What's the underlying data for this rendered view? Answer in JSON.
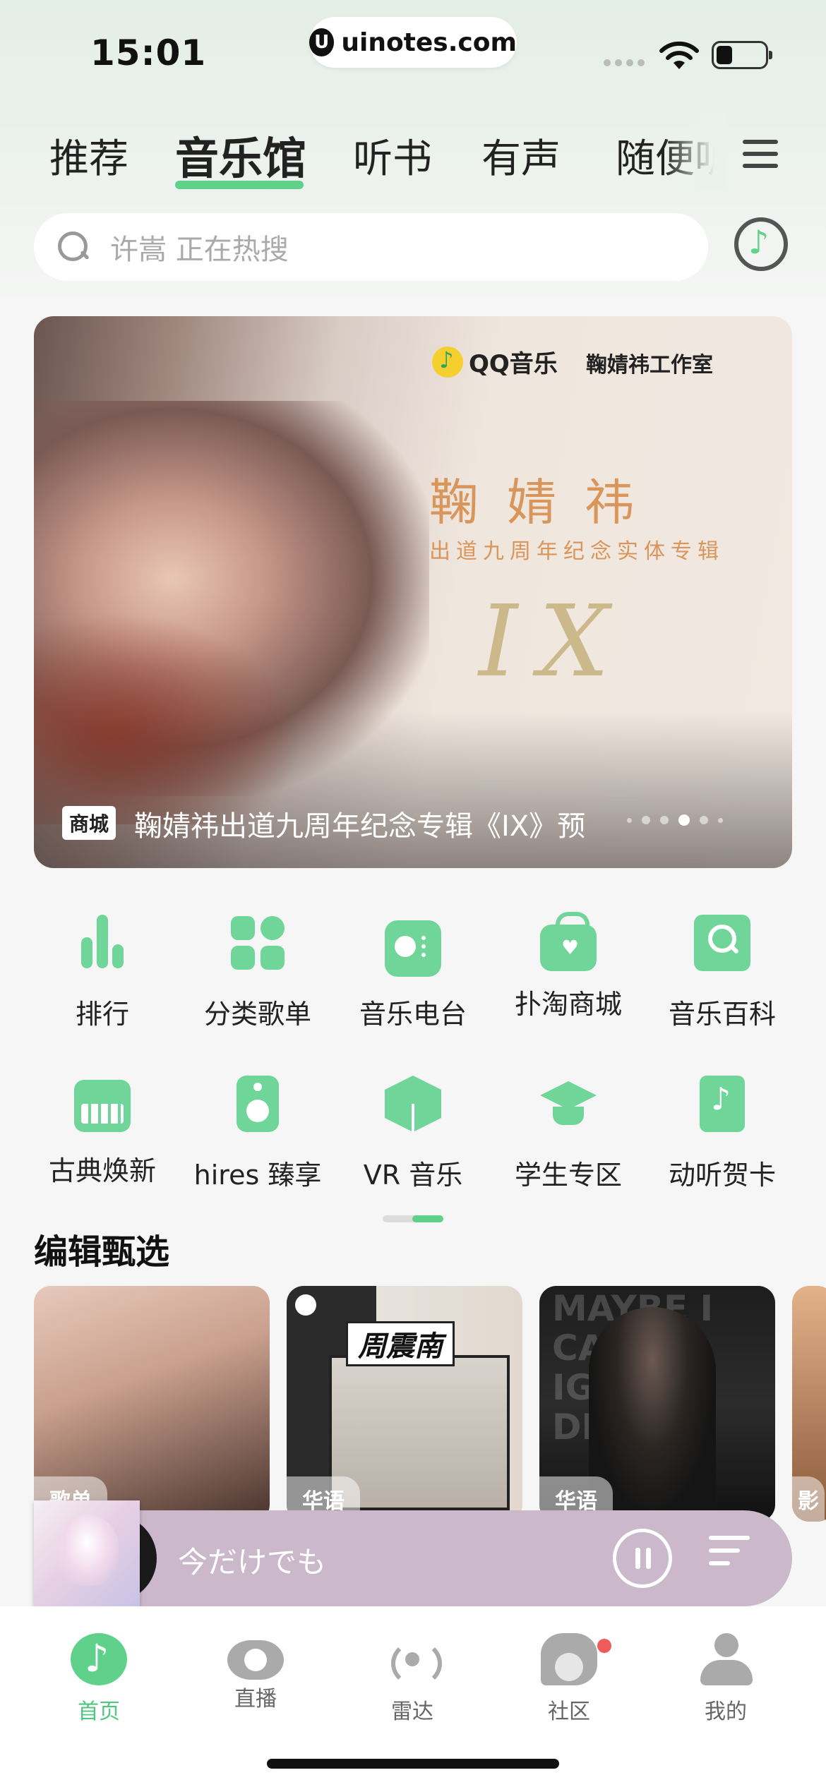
{
  "status_bar": {
    "time": "15:01",
    "url": "uinotes.com"
  },
  "top_tabs": [
    {
      "label": "推荐",
      "active": false
    },
    {
      "label": "音乐馆",
      "active": true
    },
    {
      "label": "听书",
      "active": false
    },
    {
      "label": "有声",
      "active": false
    },
    {
      "label": "随便听",
      "active": false
    }
  ],
  "search": {
    "placeholder_hint": "许嵩  正在热搜"
  },
  "banner": {
    "brand_qq": "QQ音乐",
    "brand_studio": "鞠婧祎工作室",
    "title": "鞠婧祎",
    "subtitle": "出道九周年纪念实体专辑",
    "mark": "IX",
    "tag": "商城",
    "caption": "鞠婧祎出道九周年纪念专辑《IX》预",
    "active_dot": 3
  },
  "quick_rows": [
    [
      {
        "label": "排行",
        "icon": "chart-bars-icon"
      },
      {
        "label": "分类歌单",
        "icon": "category-grid-icon"
      },
      {
        "label": "音乐电台",
        "icon": "radio-icon"
      },
      {
        "label": "扑淘商城",
        "icon": "shopping-bag-icon"
      },
      {
        "label": "音乐百科",
        "icon": "encyclopedia-icon"
      }
    ],
    [
      {
        "label": "古典焕新",
        "icon": "piano-icon"
      },
      {
        "label": "hires 臻享",
        "icon": "speaker-icon"
      },
      {
        "label": "VR 音乐",
        "icon": "cube-icon"
      },
      {
        "label": "学生专区",
        "icon": "graduation-cap-icon"
      },
      {
        "label": "动听贺卡",
        "icon": "music-card-icon"
      }
    ]
  ],
  "editor_picks": {
    "title": "编辑甄选",
    "cards": [
      {
        "tag": "歌单"
      },
      {
        "tag": "华语",
        "name": "周震南"
      },
      {
        "tag": "华语",
        "bgtext": "MAYBE I CAN IGNORE DEATH"
      },
      {
        "tag": "影"
      }
    ]
  },
  "mini_player": {
    "title": "今だけでも"
  },
  "bottom_nav": [
    {
      "label": "首页",
      "icon": "home-music-icon",
      "active": true
    },
    {
      "label": "直播",
      "icon": "eye-icon",
      "active": false
    },
    {
      "label": "雷达",
      "icon": "radar-icon",
      "active": false
    },
    {
      "label": "社区",
      "icon": "community-icon",
      "active": false
    },
    {
      "label": "我的",
      "icon": "profile-icon",
      "active": false
    }
  ]
}
